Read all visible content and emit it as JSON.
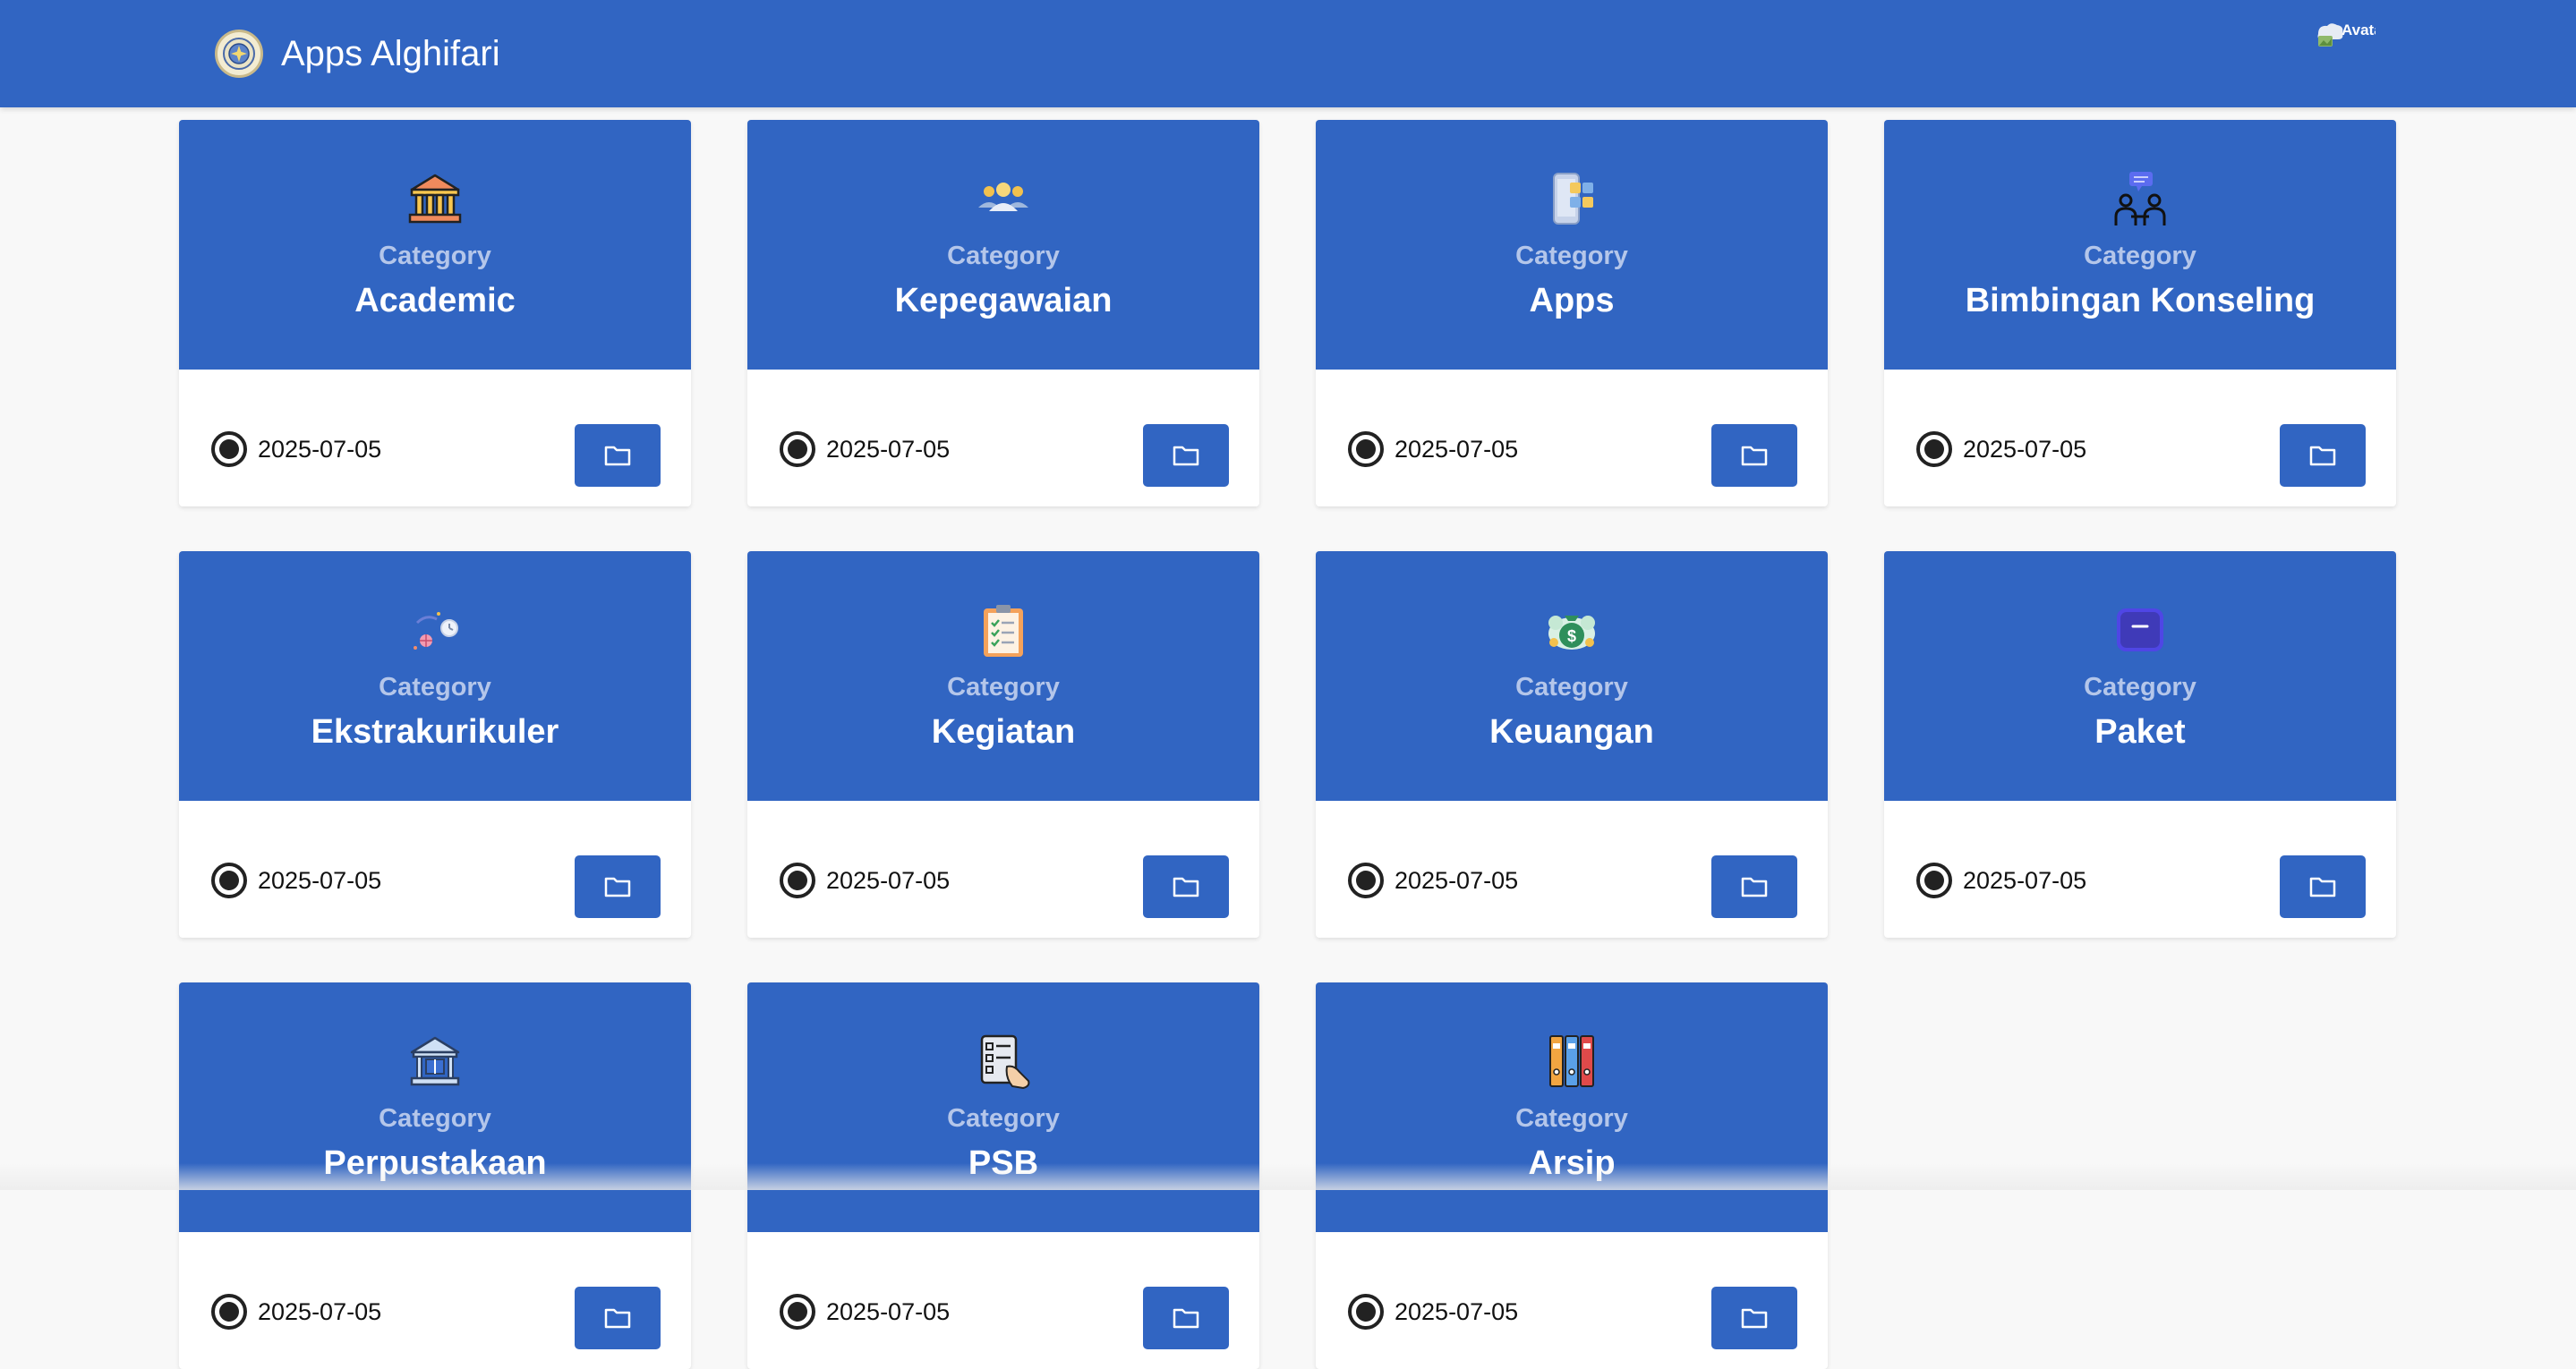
{
  "header": {
    "app_title": "Apps Alghifari",
    "avatar_alt": "Avatar",
    "brand_color": "#3165c2"
  },
  "cards": [
    {
      "category_label": "Category",
      "name": "Academic",
      "date": "2025-07-05",
      "icon": "bank-building-icon"
    },
    {
      "category_label": "Category",
      "name": "Kepegawaian",
      "date": "2025-07-05",
      "icon": "people-group-icon"
    },
    {
      "category_label": "Category",
      "name": "Apps",
      "date": "2025-07-05",
      "icon": "mobile-apps-icon"
    },
    {
      "category_label": "Category",
      "name": "Bimbingan Konseling",
      "date": "2025-07-05",
      "icon": "counseling-chat-icon"
    },
    {
      "category_label": "Category",
      "name": "Ekstrakurikuler",
      "date": "2025-07-05",
      "icon": "activities-icon"
    },
    {
      "category_label": "Category",
      "name": "Kegiatan",
      "date": "2025-07-05",
      "icon": "clipboard-checklist-icon"
    },
    {
      "category_label": "Category",
      "name": "Keuangan",
      "date": "2025-07-05",
      "icon": "money-bag-icon"
    },
    {
      "category_label": "Category",
      "name": "Paket",
      "date": "2025-07-05",
      "icon": "package-box-icon"
    },
    {
      "category_label": "Category",
      "name": "Perpustakaan",
      "date": "2025-07-05",
      "icon": "library-building-icon"
    },
    {
      "category_label": "Category",
      "name": "PSB",
      "date": "2025-07-05",
      "icon": "registration-form-icon"
    },
    {
      "category_label": "Category",
      "name": "Arsip",
      "date": "2025-07-05",
      "icon": "archive-binders-icon"
    }
  ]
}
